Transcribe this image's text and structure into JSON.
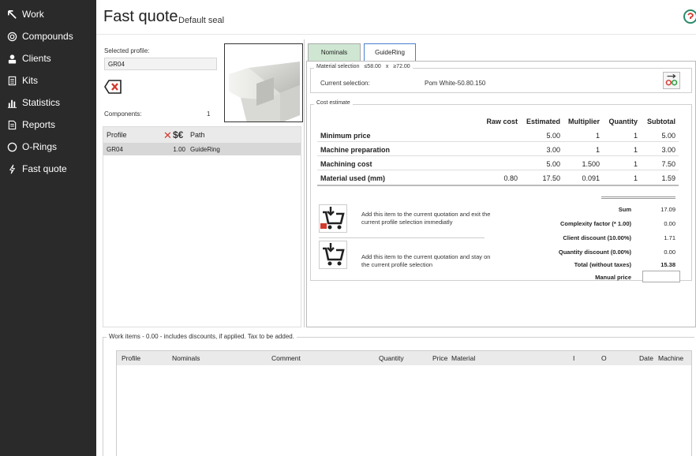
{
  "sidebar": {
    "items": [
      {
        "label": "Work",
        "icon": "arrow-icon"
      },
      {
        "label": "Compounds",
        "icon": "target-icon"
      },
      {
        "label": "Clients",
        "icon": "person-icon"
      },
      {
        "label": "Kits",
        "icon": "document-icon"
      },
      {
        "label": "Statistics",
        "icon": "bar-chart-icon"
      },
      {
        "label": "Reports",
        "icon": "report-icon"
      },
      {
        "label": "O-Rings",
        "icon": "ring-icon"
      },
      {
        "label": "Fast quote",
        "icon": "lightning-icon"
      }
    ]
  },
  "header": {
    "title": "Fast quote",
    "subtitle": "Default seal"
  },
  "left": {
    "selected_profile_label": "Selected profile:",
    "selected_profile_value": "GR04",
    "components_label": "Components:",
    "components_count": "1",
    "table": {
      "headers": {
        "profile": "Profile",
        "cost": "$€",
        "path": "Path"
      },
      "rows": [
        {
          "profile": "GR04",
          "cost": "1.00",
          "path": "GuideRing"
        }
      ]
    }
  },
  "tabs": [
    {
      "label": "Nominals"
    },
    {
      "label": "GuideRing"
    }
  ],
  "material": {
    "legend": "Material selection",
    "le_value": "≤58.00",
    "x": "x",
    "ge_value": "≥72.00",
    "current_label": "Current selection:",
    "current_value": "Pom White-50.80.150"
  },
  "cost": {
    "legend": "Cost estimate",
    "headers": [
      "Raw cost",
      "Estimated",
      "Multiplier",
      "Quantity",
      "Subtotal"
    ],
    "rows": [
      {
        "label": "Minimum price",
        "raw": "",
        "estimated": "5.00",
        "multiplier": "1",
        "quantity": "1",
        "subtotal": "5.00"
      },
      {
        "label": "Machine preparation",
        "raw": "",
        "estimated": "3.00",
        "multiplier": "1",
        "quantity": "1",
        "subtotal": "3.00"
      },
      {
        "label": "Machining cost",
        "raw": "",
        "estimated": "5.00",
        "multiplier": "1.500",
        "quantity": "1",
        "subtotal": "7.50"
      },
      {
        "label": "Material used (mm)",
        "raw": "0.80",
        "estimated": "17.50",
        "multiplier": "0.091",
        "quantity": "1",
        "subtotal": "1.59"
      }
    ],
    "add_exit_text": "Add this item to the current quotation and exit the current profile selection immediatly",
    "add_stay_text": "Add this item to the current quotation and stay on the current profile selection",
    "summary": [
      {
        "label": "Sum",
        "value": "17.09"
      },
      {
        "label": "Complexity factor (* 1.00)",
        "value": "0.00"
      },
      {
        "label": "Client discount (10.00%)",
        "value": "1.71"
      },
      {
        "label": "Quantity discount (0.00%)",
        "value": "0.00"
      },
      {
        "label": "Total (without taxes)",
        "value": "15.38"
      },
      {
        "label": "Manual price",
        "value": ""
      }
    ]
  },
  "work_items": {
    "legend": "Work items - 0.00 - includes discounts, if applied. Tax to be added.",
    "headers": [
      "Profile",
      "Nominals",
      "Comment",
      "Quantity",
      "Price",
      "Material",
      "I",
      "O",
      "Date",
      "Machine"
    ]
  },
  "colors": {
    "sidebar_bg": "#2a2a2a",
    "tab_active_border": "#4a7fd1",
    "tab_inactive_bg": "#cfe7d2",
    "delete_red": "#d23a2e"
  }
}
